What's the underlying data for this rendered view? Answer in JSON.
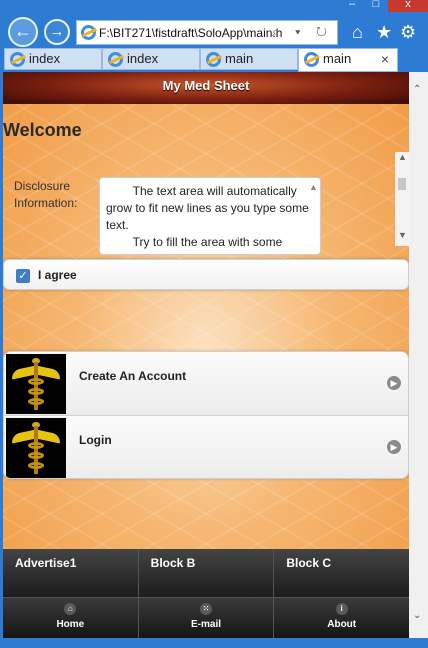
{
  "browser": {
    "window_controls": {
      "minimize": "–",
      "maximize": "□",
      "close": "x"
    },
    "address": "F:\\BIT271\\fistdraft\\SoloApp\\main.h",
    "address_tools": "⌕ ▾ ↻",
    "tabs": [
      {
        "label": "index",
        "active": false
      },
      {
        "label": "index",
        "active": false
      },
      {
        "label": "main",
        "active": false
      },
      {
        "label": "main",
        "active": true
      }
    ],
    "tab_close": "×",
    "icons": {
      "back": "←",
      "forward": "→",
      "home": "⌂",
      "favorites": "★",
      "settings": "⚙"
    }
  },
  "page": {
    "header_title": "My Med Sheet",
    "welcome": "Welcome",
    "disclosure_label": "Disclosure Information:",
    "disclosure_text": "        The text area will automatically grow to fit new lines as you type some text.\n        Try to fill the area with some",
    "agree_label": "I agree",
    "agree_checked": true,
    "list_items": [
      {
        "label": "Create An Account",
        "icon": "caduceus"
      },
      {
        "label": "Login",
        "icon": "caduceus"
      }
    ],
    "blocks": [
      "Advertise1",
      "Block B",
      "Block C"
    ],
    "nav_buttons": [
      {
        "label": "Home",
        "icon": "home"
      },
      {
        "label": "E-mail",
        "icon": "grid"
      },
      {
        "label": "About",
        "icon": "info"
      }
    ]
  },
  "colors": {
    "browser_chrome": "#2d7bd3",
    "header_red": "#7a1f10",
    "background_orange": "#f09a43",
    "footer_dark": "#1c1c1c",
    "checkbox_blue": "#3f7ec7"
  }
}
